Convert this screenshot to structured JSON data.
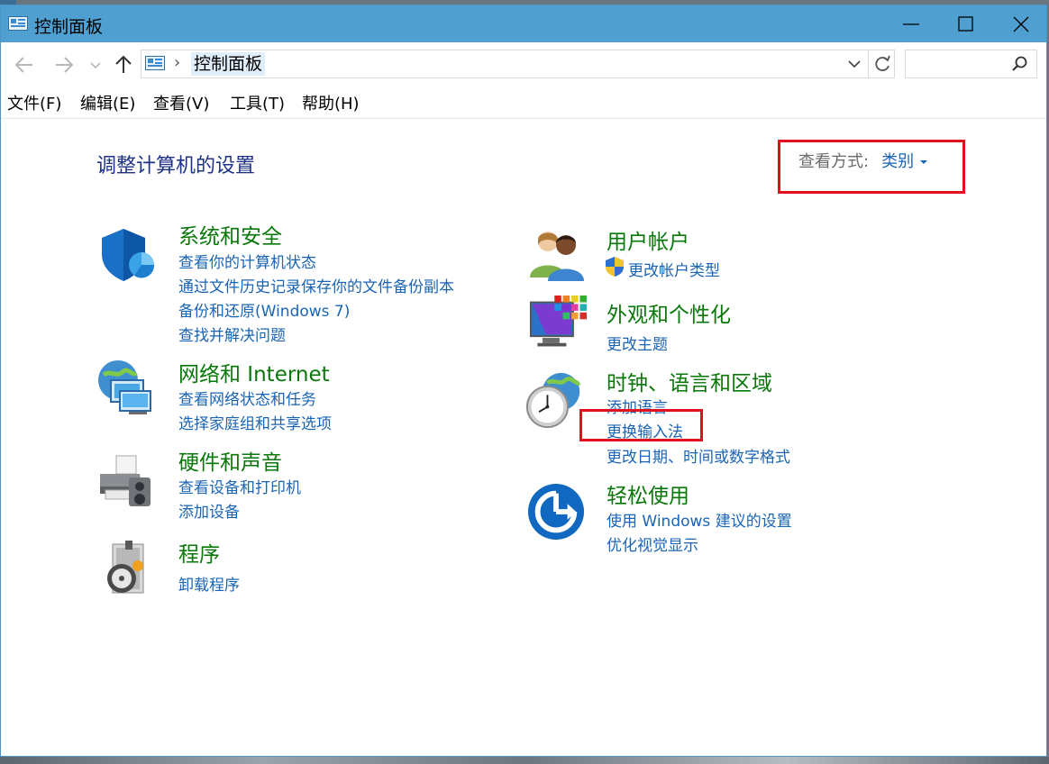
{
  "window": {
    "title": "控制面板",
    "controls": {
      "minimize_icon": "minimize-icon",
      "maximize_icon": "maximize-icon",
      "close_icon": "close-icon"
    }
  },
  "address_bar": {
    "breadcrumb": "控制面板",
    "search_placeholder": ""
  },
  "menu": {
    "items": [
      "文件(F)",
      "编辑(E)",
      "查看(V)",
      "工具(T)",
      "帮助(H)"
    ]
  },
  "main": {
    "heading": "调整计算机的设置",
    "view_by": {
      "label": "查看方式:",
      "value": "类别"
    },
    "categories": [
      {
        "title": "系统和安全",
        "icon": "shield-icon",
        "links": [
          "查看你的计算机状态",
          "通过文件历史记录保存你的文件备份副本",
          "备份和还原(Windows 7)",
          "查找并解决问题"
        ]
      },
      {
        "title": "网络和 Internet",
        "icon": "network-icon",
        "links": [
          "查看网络状态和任务",
          "选择家庭组和共享选项"
        ]
      },
      {
        "title": "硬件和声音",
        "icon": "printer-icon",
        "links": [
          "查看设备和打印机",
          "添加设备"
        ]
      },
      {
        "title": "程序",
        "icon": "programs-icon",
        "links": [
          "卸载程序"
        ]
      },
      {
        "title": "用户帐户",
        "icon": "users-icon",
        "links": [
          "更改帐户类型"
        ]
      },
      {
        "title": "外观和个性化",
        "icon": "monitor-palette-icon",
        "links": [
          "更改主题"
        ]
      },
      {
        "title": "时钟、语言和区域",
        "icon": "clock-globe-icon",
        "links": [
          "添加语言",
          "更换输入法",
          "更改日期、时间或数字格式"
        ]
      },
      {
        "title": "轻松使用",
        "icon": "ease-of-access-icon",
        "links": [
          "使用 Windows 建议的设置",
          "优化视觉显示"
        ]
      }
    ]
  },
  "colors": {
    "titlebar": "#4f9fd1",
    "category_title": "#097709",
    "link": "#1a64b4",
    "heading": "#1e3287",
    "highlight_box": "#e0101e"
  }
}
